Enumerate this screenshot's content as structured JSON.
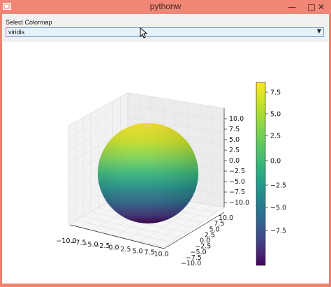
{
  "window": {
    "title": "pythonw",
    "minimize_glyph": "—",
    "maximize_glyph": "□",
    "close_glyph": "✕"
  },
  "controls": {
    "label": "Select Colormap",
    "combo_value": "viridis",
    "combo_arrow": "▼"
  },
  "plot": {
    "x_ticks": [
      "−10.0",
      "−7.5",
      "−5.0",
      "−2.5",
      "0.0",
      "2.5",
      "5.0",
      "7.5",
      "10.0"
    ],
    "y_ticks": [
      "−10.0",
      "−7.5",
      "−5.0",
      "−2.5",
      "0.0",
      "2.5",
      "5.0",
      "7.5",
      "10.0"
    ],
    "z_ticks": [
      "−10.0",
      "−7.5",
      "−5.0",
      "−2.5",
      "0.0",
      "2.5",
      "5.0",
      "7.5",
      "10.0"
    ],
    "colorbar_ticks": [
      "7.5",
      "5.0",
      "2.5",
      "0.0",
      "−2.5",
      "−5.0",
      "−7.5"
    ],
    "colormap": "viridis",
    "colors": {
      "top": "#fde725",
      "mid": "#21918c",
      "bottom": "#440154"
    }
  }
}
